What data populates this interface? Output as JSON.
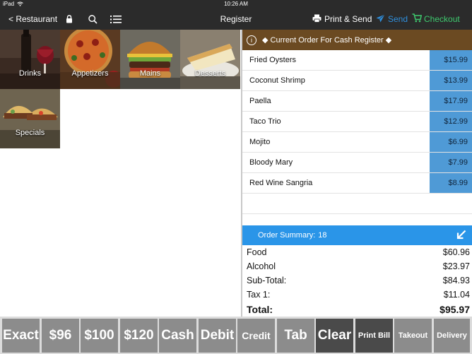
{
  "status": {
    "device": "iPad",
    "time": "10:26 AM"
  },
  "nav": {
    "back_label": "< Restaurant",
    "title": "Register",
    "print_send_label": "Print & Send",
    "send_label": "Send",
    "checkout_label": "Checkout",
    "colors": {
      "send": "#2f8fdd",
      "checkout": "#3ec96e",
      "bar": "#2b2b2b"
    }
  },
  "categories": [
    {
      "label": "Drinks",
      "icon": "wine-glass-photo"
    },
    {
      "label": "Appetizers",
      "icon": "pizza-photo"
    },
    {
      "label": "Mains",
      "icon": "burger-photo"
    },
    {
      "label": "Desserts",
      "icon": "cheesecake-photo"
    },
    {
      "label": "Specials",
      "icon": "tacos-photo"
    }
  ],
  "order": {
    "header": "◆ Current Order For Cash Register ◆",
    "items": [
      {
        "name": "Fried Oysters",
        "price": "$15.99"
      },
      {
        "name": "Coconut Shrimp",
        "price": "$13.99"
      },
      {
        "name": "Paella",
        "price": "$17.99"
      },
      {
        "name": "Taco Trio",
        "price": "$12.99"
      },
      {
        "name": "Mojito",
        "price": "$6.99"
      },
      {
        "name": "Bloody Mary",
        "price": "$7.99"
      },
      {
        "name": "Red Wine Sangria",
        "price": "$8.99"
      }
    ],
    "colors": {
      "header": "#6b4a22",
      "price_cell": "#4f9ad6",
      "summary_bar": "#2a95e8"
    }
  },
  "summary": {
    "label": "Order Summary:",
    "count": "18",
    "food_label": "Food",
    "food_value": "$60.96",
    "alcohol_label": "Alcohol",
    "alcohol_value": "$23.97",
    "subtotal_label": "Sub-Total:",
    "subtotal_value": "$84.93",
    "tax_label": "Tax 1:",
    "tax_value": "$11.04",
    "total_label": "Total:",
    "total_value": "$95.97"
  },
  "buttons": [
    {
      "label": "Exact"
    },
    {
      "label": "$96"
    },
    {
      "label": "$100"
    },
    {
      "label": "$120"
    },
    {
      "label": "Cash"
    },
    {
      "label": "Debit"
    },
    {
      "label": "Credit"
    },
    {
      "label": "Tab"
    },
    {
      "label": "Clear"
    },
    {
      "label": "Print Bill"
    },
    {
      "label": "Takeout"
    },
    {
      "label": "Delivery"
    }
  ]
}
